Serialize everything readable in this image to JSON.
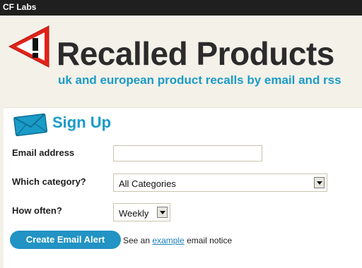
{
  "topbar": {
    "brand": "CF Labs"
  },
  "header": {
    "title": "Recalled Products",
    "tagline": "uk and european product recalls by email and rss",
    "logo_icon": "warning-triangle-icon",
    "accent_color": "#1a9bc8",
    "logo_color": "#e2231a"
  },
  "signup": {
    "title": "Sign Up",
    "icon": "envelope-icon",
    "email_label": "Email address",
    "email_value": "",
    "category_label": "Which category?",
    "category_value": "All Categories",
    "frequency_label": "How often?",
    "frequency_value": "Weekly",
    "submit_label": "Create Email Alert",
    "notice_prefix": "See an",
    "notice_link": "example",
    "notice_suffix": "email notice"
  }
}
